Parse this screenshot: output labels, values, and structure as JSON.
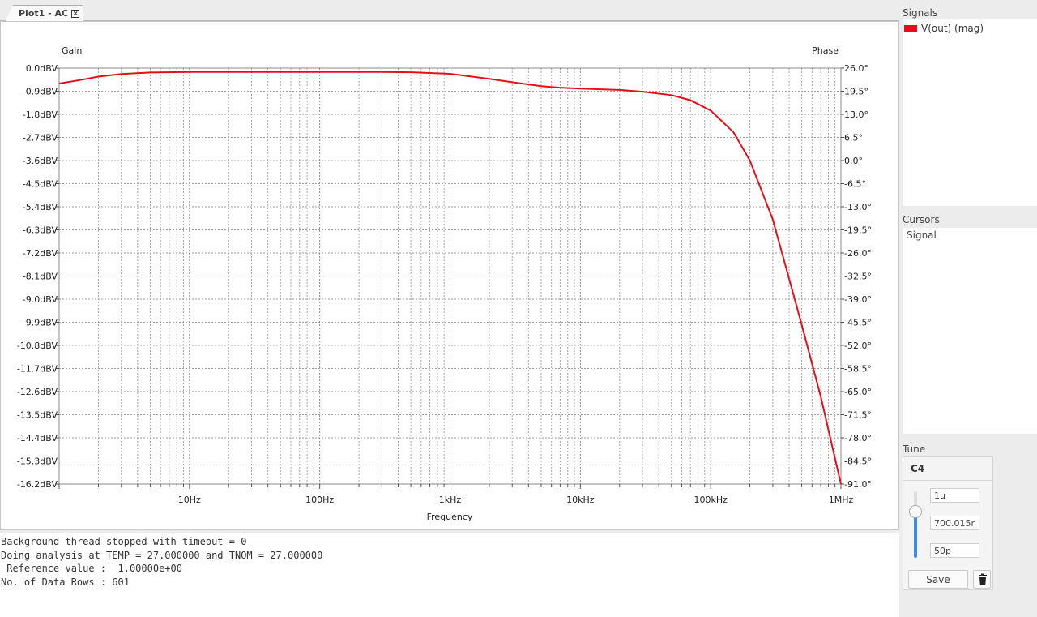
{
  "tab": {
    "title": "Plot1 - AC",
    "close_glyph": "×"
  },
  "chart_data": {
    "type": "line",
    "left_axis_title": "Gain",
    "right_axis_title": "Phase",
    "xlabel": "Frequency",
    "x_scale": "log",
    "xlim": [
      1,
      1000000
    ],
    "ylim": [
      -16.2,
      0.0
    ],
    "grid": true,
    "x_tick_labels": [
      {
        "value": 10,
        "label": "10Hz"
      },
      {
        "value": 100,
        "label": "100Hz"
      },
      {
        "value": 1000,
        "label": "1kHz"
      },
      {
        "value": 10000,
        "label": "10kHz"
      },
      {
        "value": 100000,
        "label": "100kHz"
      },
      {
        "value": 1000000,
        "label": "1MHz"
      }
    ],
    "left_tick_labels": [
      "0.0dBV",
      "-0.9dBV",
      "-1.8dBV",
      "-2.7dBV",
      "-3.6dBV",
      "-4.5dBV",
      "-5.4dBV",
      "-6.3dBV",
      "-7.2dBV",
      "-8.1dBV",
      "-9.0dBV",
      "-9.9dBV",
      "-10.8dBV",
      "-11.7dBV",
      "-12.6dBV",
      "-13.5dBV",
      "-14.4dBV",
      "-15.3dBV",
      "-16.2dBV"
    ],
    "right_tick_labels": [
      "26.0°",
      "19.5°",
      "13.0°",
      "6.5°",
      "0.0°",
      "-6.5°",
      "-13.0°",
      "-19.5°",
      "-26.0°",
      "-32.5°",
      "-39.0°",
      "-45.5°",
      "-52.0°",
      "-58.5°",
      "-65.0°",
      "-71.5°",
      "-78.0°",
      "-84.5°",
      "-91.0°"
    ],
    "series": [
      {
        "name": "V(out) (mag)",
        "color": "#e3101a",
        "x": [
          1,
          1.5,
          2,
          3,
          5,
          10,
          50,
          100,
          300,
          500,
          1000,
          2000,
          3000,
          5000,
          7000,
          10000,
          20000,
          30000,
          50000,
          70000,
          100000,
          150000,
          200000,
          300000,
          400000,
          500000,
          700000,
          1000000
        ],
        "y": [
          -0.6,
          -0.45,
          -0.33,
          -0.23,
          -0.17,
          -0.15,
          -0.15,
          -0.15,
          -0.15,
          -0.16,
          -0.22,
          -0.42,
          -0.55,
          -0.7,
          -0.76,
          -0.8,
          -0.85,
          -0.92,
          -1.05,
          -1.25,
          -1.65,
          -2.5,
          -3.6,
          -5.9,
          -8.2,
          -10.0,
          -12.8,
          -16.2
        ]
      }
    ]
  },
  "console": {
    "lines": [
      "Background thread stopped with timeout = 0",
      "Doing analysis at TEMP = 27.000000 and TNOM = 27.000000",
      " Reference value :  1.00000e+00",
      "No. of Data Rows : 601"
    ]
  },
  "signals": {
    "title": "Signals",
    "items": [
      {
        "label": "V(out) (mag)",
        "color": "#e3101a"
      }
    ]
  },
  "cursors": {
    "title": "Cursors",
    "column": "Signal"
  },
  "tune": {
    "title": "Tune",
    "component": "C4",
    "max_value": "1u",
    "current_value": "700.015n",
    "min_value": "50p",
    "slider_fraction": 0.7,
    "save_label": "Save",
    "delete_icon": "trash-icon"
  }
}
